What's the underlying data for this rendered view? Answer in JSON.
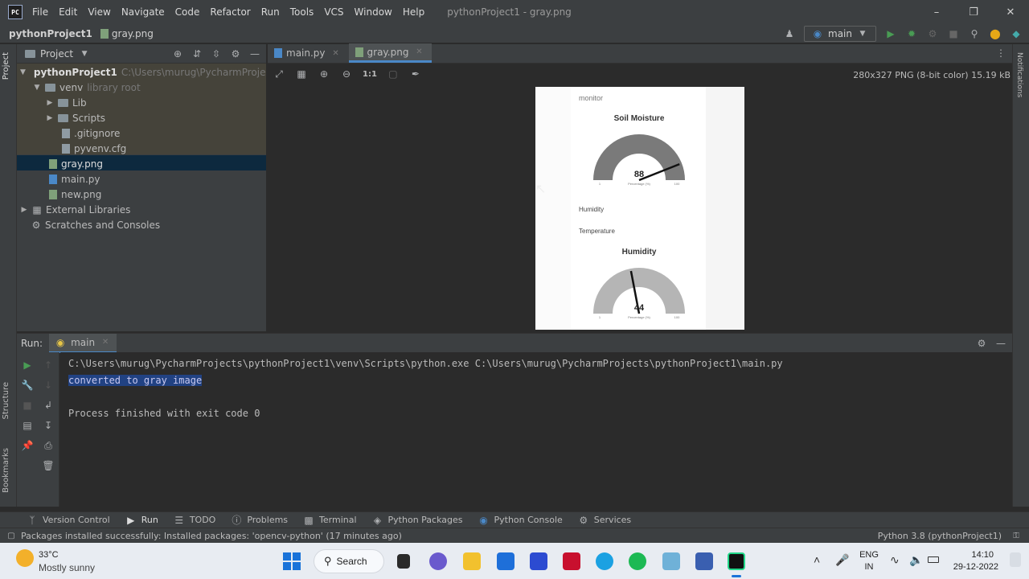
{
  "app": {
    "logo": "PC",
    "window_title": "pythonProject1 - gray.png"
  },
  "menu": [
    "File",
    "Edit",
    "View",
    "Navigate",
    "Code",
    "Refactor",
    "Run",
    "Tools",
    "VCS",
    "Window",
    "Help"
  ],
  "breadcrumb": {
    "project": "pythonProject1",
    "file": "gray.png"
  },
  "run_config": "main",
  "project_panel": {
    "title": "Project",
    "root": {
      "name": "pythonProject1",
      "path": "C:\\Users\\murug\\PycharmProjects\\pyt"
    },
    "venv": {
      "name": "venv",
      "hint": "library root"
    },
    "items": [
      "Lib",
      "Scripts",
      ".gitignore",
      "pyvenv.cfg",
      "gray.png",
      "main.py",
      "new.png",
      "External Libraries",
      "Scratches and Consoles"
    ]
  },
  "left_stripe": {
    "project": "Project",
    "structure": "Structure",
    "bookmarks": "Bookmarks"
  },
  "right_stripe": {
    "notifications": "Notifications"
  },
  "editor_tabs": [
    {
      "label": "main.py"
    },
    {
      "label": "gray.png"
    }
  ],
  "image_tools": {
    "actual_size": "1:1"
  },
  "image_info": "280x327 PNG (8-bit color) 15.19 kB",
  "preview": {
    "monitor": "monitor",
    "soil_title": "Soil Moisture",
    "soil_value": "88",
    "soil_min": "1",
    "soil_max": "100",
    "soil_unit": "Percentage (%)",
    "humidity_label": "Humidity",
    "temperature_label": "Temperature",
    "hum_title": "Humidity",
    "hum_value": "44",
    "hum_min": "1",
    "hum_max": "100",
    "hum_unit": "Percentage (%)",
    "soil_fraction": 0.88,
    "hum_fraction": 0.44
  },
  "run_panel": {
    "title": "Run:",
    "tab": "main"
  },
  "console": [
    "C:\\Users\\murug\\PycharmProjects\\pythonProject1\\venv\\Scripts\\python.exe C:\\Users\\murug\\PycharmProjects\\pythonProject1\\main.py",
    "converted to gray image",
    "",
    "Process finished with exit code 0"
  ],
  "bottom_tabs": [
    "Version Control",
    "Run",
    "TODO",
    "Problems",
    "Terminal",
    "Python Packages",
    "Python Console",
    "Services"
  ],
  "status": {
    "message": "Packages installed successfully: Installed packages: 'opencv-python' (17 minutes ago)",
    "interpreter": "Python 3.8 (pythonProject1)"
  },
  "taskbar": {
    "weather_temp": "33°C",
    "weather_desc": "Mostly sunny",
    "search": "Search",
    "lang1": "ENG",
    "lang2": "IN",
    "time": "14:10",
    "date": "29-12-2022"
  },
  "colors": {
    "accent": "#4a88c7",
    "run_green": "#499c54",
    "selection": "#214283"
  }
}
